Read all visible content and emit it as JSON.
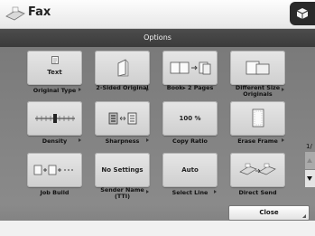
{
  "app": {
    "title": "Fax",
    "icon": "fax-icon"
  },
  "header": {
    "title": "Options"
  },
  "rows": [
    [
      {
        "key": "original-type",
        "label": "Original Type",
        "tile_text": "Text",
        "icon": "text-document-icon"
      },
      {
        "key": "2-sided-original",
        "label": "2-Sided Original",
        "tile_text": "",
        "icon": "2-sided-document-icon"
      },
      {
        "key": "book-2-pages",
        "label": "Book▸ 2 Pages",
        "tile_text": "",
        "icon": "book-to-pages-icon"
      },
      {
        "key": "different-size-originals",
        "label": "Different Size Originals",
        "tile_text": "",
        "icon": "different-size-originals-icon"
      }
    ],
    [
      {
        "key": "density",
        "label": "Density",
        "tile_text": "",
        "icon": "density-slider-icon"
      },
      {
        "key": "sharpness",
        "label": "Sharpness",
        "tile_text": "",
        "icon": "sharpness-icon"
      },
      {
        "key": "copy-ratio",
        "label": "Copy Ratio",
        "tile_text": "100 %",
        "icon": ""
      },
      {
        "key": "erase-frame",
        "label": "Erase Frame",
        "tile_text": "",
        "icon": "erase-frame-icon"
      }
    ],
    [
      {
        "key": "job-build",
        "label": "Job Build",
        "tile_text": "",
        "icon": "job-build-icon"
      },
      {
        "key": "sender-name-tti",
        "label": "Sender Name (TTI)",
        "tile_text": "No Settings",
        "icon": ""
      },
      {
        "key": "select-line",
        "label": "Select Line",
        "tile_text": "Auto",
        "icon": ""
      },
      {
        "key": "direct-send",
        "label": "Direct Send",
        "tile_text": "",
        "icon": "direct-send-icon"
      }
    ]
  ],
  "page_indicator": "1/",
  "footer": {
    "close_label": "Close"
  },
  "colors": {
    "title_bar": "#efefef",
    "options_bar": "#454545",
    "panel": "#808080",
    "tile": "#dadada"
  }
}
